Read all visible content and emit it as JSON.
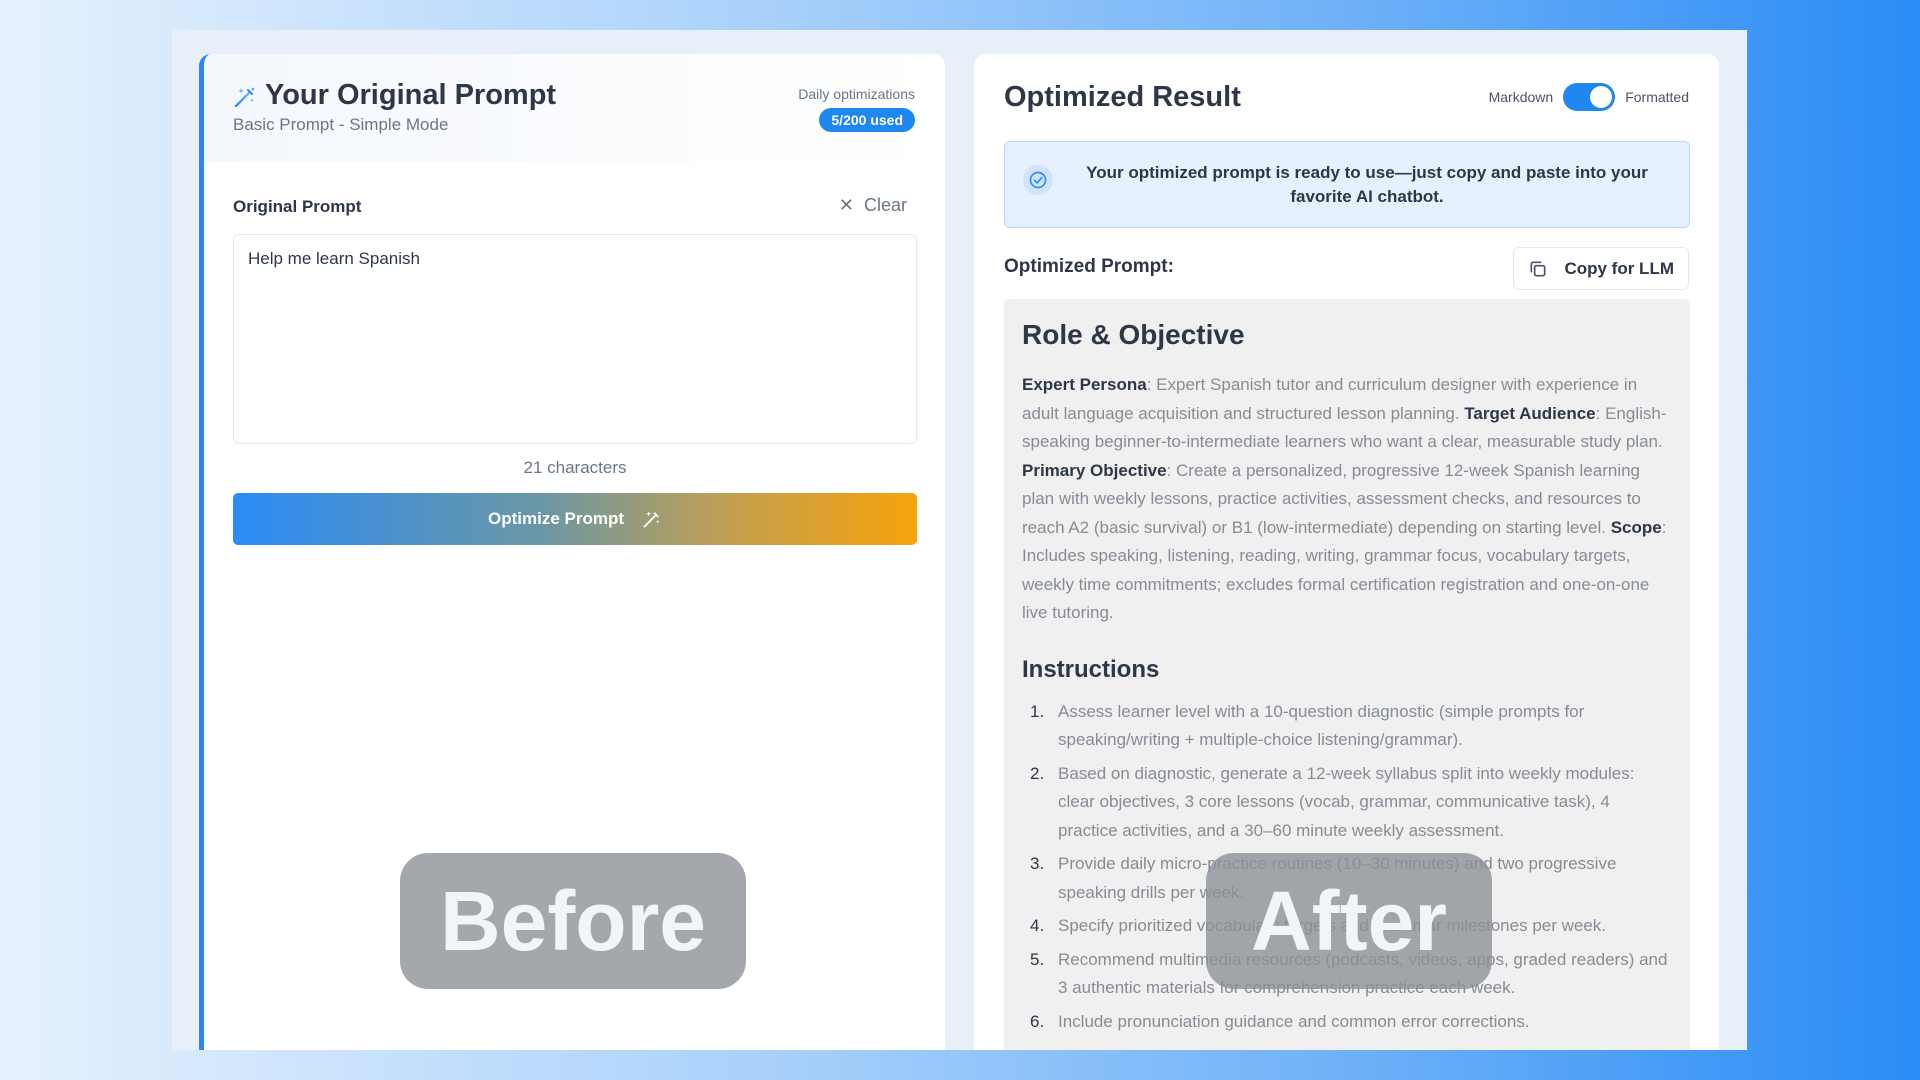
{
  "left": {
    "title": "Your Original Prompt",
    "subtitle": "Basic Prompt - Simple Mode",
    "daily_label": "Daily optimizations",
    "usage_badge": "5/200 used",
    "section_label": "Original Prompt",
    "clear_label": "Clear",
    "prompt_value": "Help me learn Spanish",
    "char_count": "21 characters",
    "optimize_label": "Optimize Prompt"
  },
  "right": {
    "title": "Optimized Result",
    "toggle_left": "Markdown",
    "toggle_right": "Formatted",
    "toggle_on": true,
    "info": "Your optimized prompt is ready to use—just copy and paste into your favorite AI chatbot.",
    "prompt_label": "Optimized Prompt:",
    "copy_label": "Copy for LLM",
    "content": {
      "heading1": "Role & Objective",
      "p_expert_label": "Expert Persona",
      "p_expert_text": ": Expert Spanish tutor and curriculum designer with experience in adult language acquisition and structured lesson planning. ",
      "p_target_label": "Target Audience",
      "p_target_text": ": English-speaking beginner-to-intermediate learners who want a clear, measurable study plan. ",
      "p_primary_label": "Primary Objective",
      "p_primary_text": ": Create a personalized, progressive 12-week Spanish learning plan with weekly lessons, practice activities, assessment checks, and resources to reach A2 (basic survival) or B1 (low-intermediate) depending on starting level. ",
      "p_scope_label": "Scope",
      "p_scope_text": ": Includes speaking, listening, reading, writing, grammar focus, vocabulary targets, weekly time commitments; excludes formal certification registration and one-on-one live tutoring.",
      "heading2": "Instructions",
      "items": [
        {
          "n": "1.",
          "t": "Assess learner level with a 10-question diagnostic (simple prompts for speaking/writing + multiple-choice listening/grammar)."
        },
        {
          "n": "2.",
          "t": "Based on diagnostic, generate a 12-week syllabus split into weekly modules: clear objectives, 3 core lessons (vocab, grammar, communicative task), 4 practice activities, and a 30–60 minute weekly assessment."
        },
        {
          "n": "3.",
          "t": "Provide daily micro-practice routines (10–30 minutes) and two progressive speaking drills per week."
        },
        {
          "n": "4.",
          "t": "Specify prioritized vocabulary targets and grammar milestones per week."
        },
        {
          "n": "5.",
          "t": "Recommend multimedia resources (podcasts, videos, apps, graded readers) and 3 authentic materials for comprehension practice each week."
        },
        {
          "n": "6.",
          "t": "Include pronunciation guidance and common error corrections."
        }
      ]
    }
  },
  "overlays": {
    "before": "Before",
    "after": "After"
  }
}
